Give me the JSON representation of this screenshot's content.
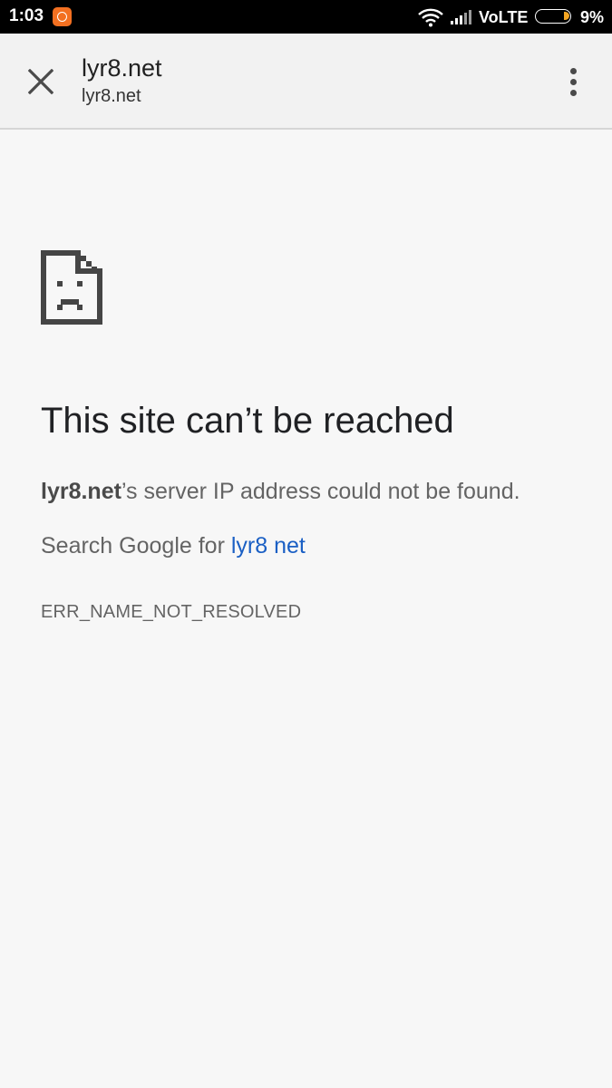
{
  "status_bar": {
    "time": "1:03",
    "network": "VoLTE",
    "battery": "9%",
    "battery_level": 0.09,
    "icons": [
      "app-notification-icon",
      "wifi-icon",
      "signal-icon",
      "battery-icon"
    ]
  },
  "toolbar": {
    "title": "lyr8.net",
    "url": "lyr8.net",
    "icons": [
      "close-icon",
      "more-vert-icon"
    ]
  },
  "error": {
    "icon": "sad-page-icon",
    "heading": "This site can’t be reached",
    "host": "lyr8.net",
    "detail_suffix": "’s server IP address could not be found.",
    "search_prefix": "Search Google for ",
    "search_link": "lyr8 net",
    "code": "ERR_NAME_NOT_RESOLVED"
  },
  "colors": {
    "page_bg": "#f7f7f7",
    "toolbar_bg": "#f2f2f2",
    "link": "#1a5fc4",
    "notification_accent": "#f37021",
    "battery_fill": "#f5a623"
  }
}
